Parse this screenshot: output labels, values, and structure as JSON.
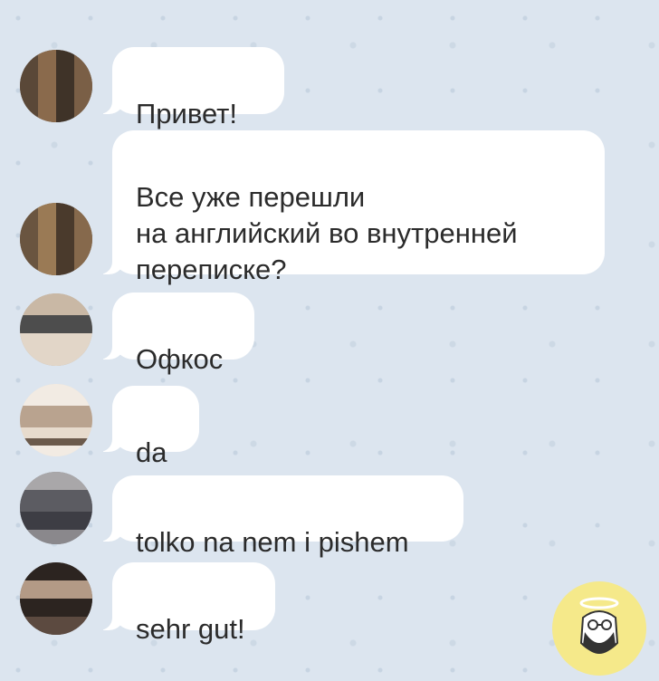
{
  "messages": [
    {
      "text": "Привет!"
    },
    {
      "text": "Все уже перешли\nна английский во внутренней\nпереписке?"
    },
    {
      "text": "Офкос"
    },
    {
      "text": "da"
    },
    {
      "text": "tolko na nem i pishem"
    },
    {
      "text": "sehr gut!"
    }
  ],
  "avatars": [
    {
      "colors": [
        "#5a4838",
        "#8a6a4c",
        "#3f3328"
      ]
    },
    {
      "colors": [
        "#6a5540",
        "#9a7a55",
        "#4a3a2c"
      ]
    },
    {
      "colors": [
        "#c9b8a5",
        "#4d4d4d",
        "#e2d6c8"
      ]
    },
    {
      "colors": [
        "#e7dbcd",
        "#6b5a4c",
        "#f2ebe3"
      ]
    },
    {
      "colors": [
        "#7c7c82",
        "#3d3d44",
        "#a9a7a9"
      ]
    },
    {
      "colors": [
        "#2c2420",
        "#b39a86",
        "#5c4a40"
      ]
    }
  ],
  "watermark": {
    "icon": "bearded-man-halo-logo-icon"
  }
}
